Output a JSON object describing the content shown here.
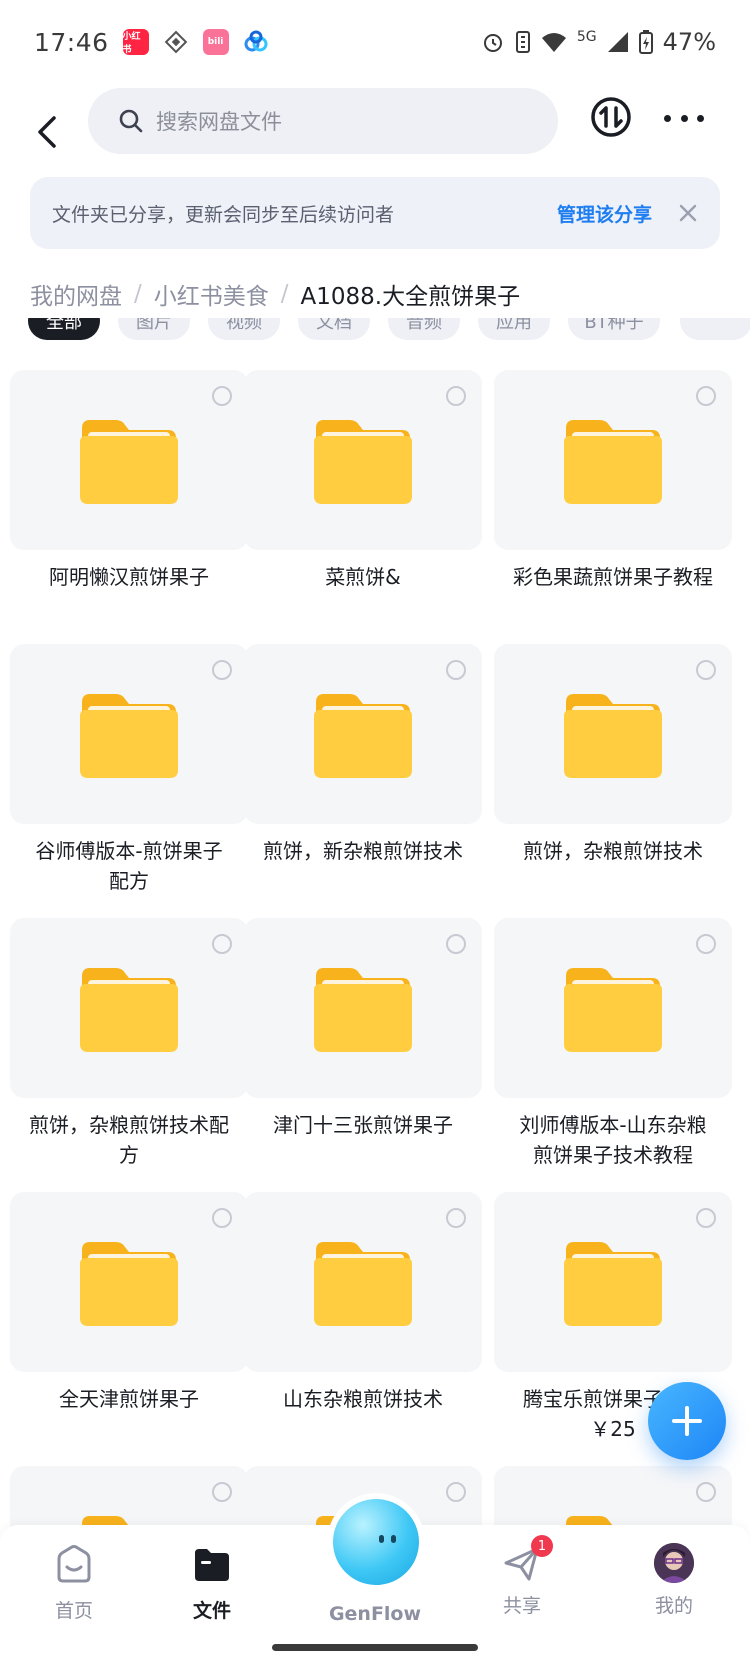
{
  "status_bar": {
    "time": "17:46",
    "network": "5G",
    "battery": "47%"
  },
  "header": {
    "search_placeholder": "搜索网盘文件"
  },
  "notice": {
    "text": "文件夹已分享，更新会同步至后续访问者",
    "manage_label": "管理该分享"
  },
  "breadcrumb": {
    "items": [
      "我的网盘",
      "小红书美食"
    ],
    "current": "A1088.大全煎饼果子"
  },
  "tabs": [
    "全部",
    "图片",
    "视频",
    "文档",
    "音频",
    "应用",
    "BT种子"
  ],
  "folders": [
    "阿明懒汉煎饼果子",
    "菜煎饼&",
    "彩色果蔬煎饼果子教程",
    "谷师傅版本-煎饼果子配方",
    "煎饼，新杂粮煎饼技术",
    "煎饼，杂粮煎饼技术",
    "煎饼，杂粮煎饼技术配方",
    "津门十三张煎饼果子",
    "刘师傅版本-山东杂粮煎饼果子技术教程",
    "全天津煎饼果子",
    "山东杂粮煎饼技术",
    "腾宝乐煎饼果子配方 ￥25"
  ],
  "bottom_nav": {
    "home": "首页",
    "files": "文件",
    "genflow": "GenFlow",
    "share": "共享",
    "share_badge": "1",
    "mine": "我的"
  },
  "colors": {
    "accent": "#1e7df0",
    "folder": "#ffc93c",
    "badge": "#f0384f"
  }
}
